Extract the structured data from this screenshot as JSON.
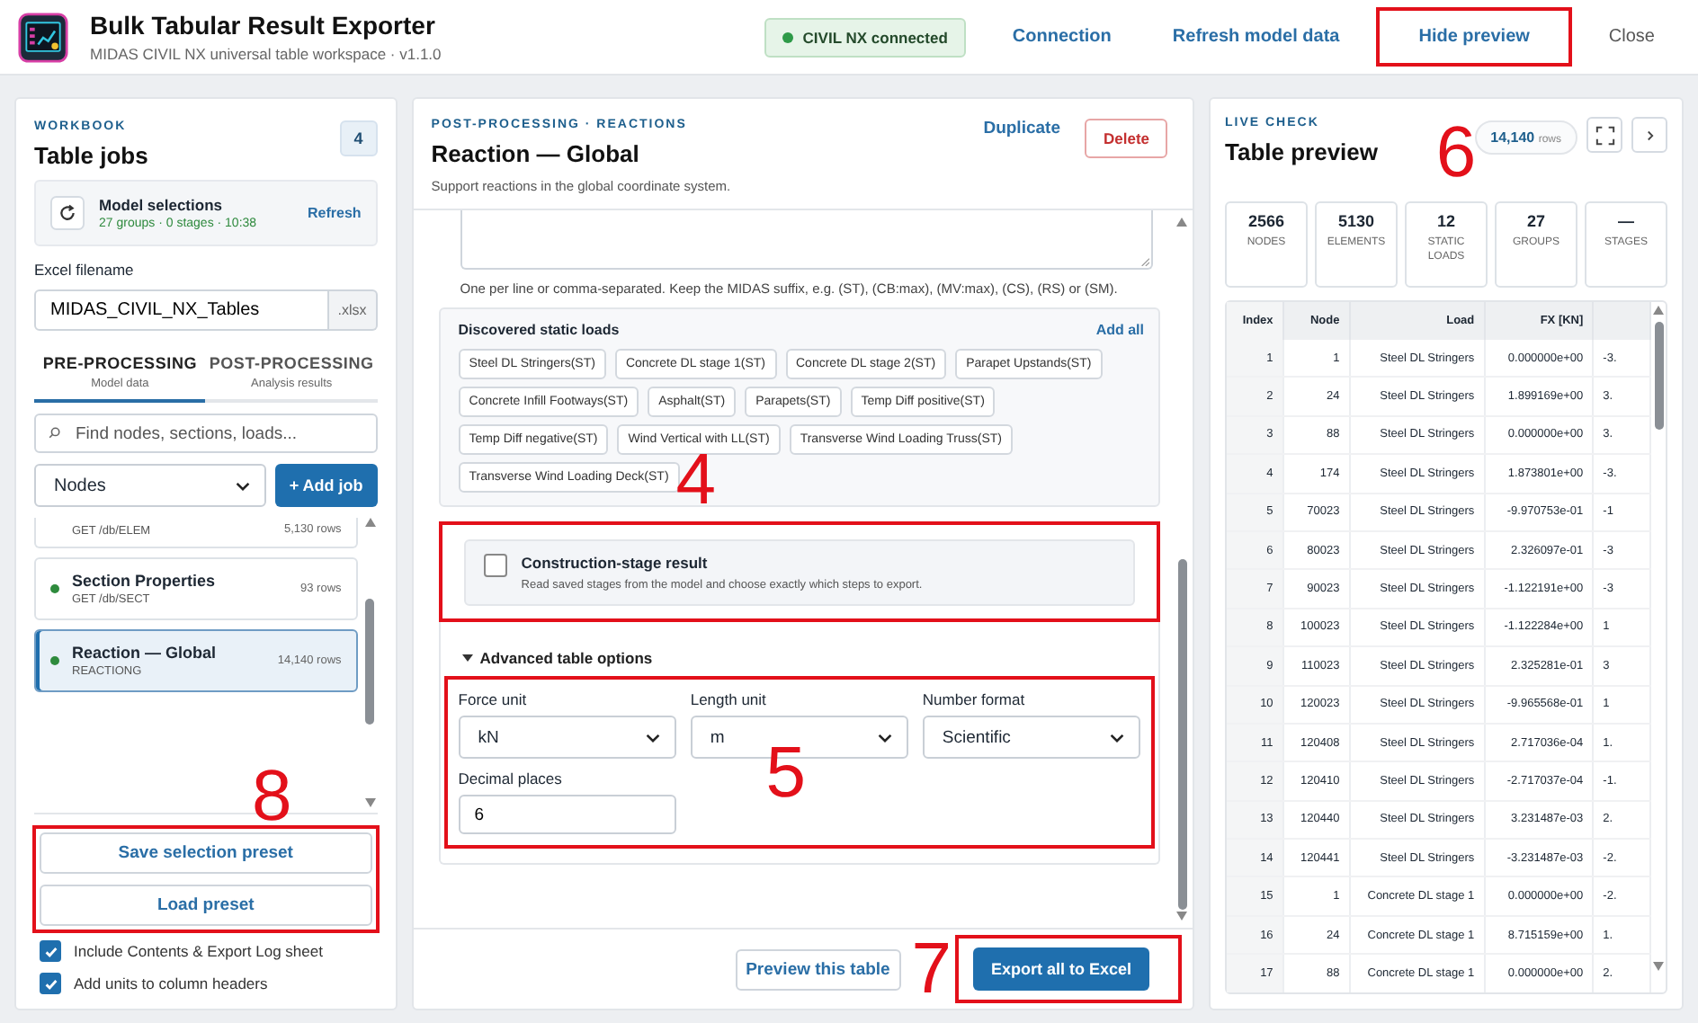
{
  "app": {
    "title": "Bulk Tabular Result Exporter",
    "subtitle": "MIDAS CIVIL NX universal table workspace · v1.1.0"
  },
  "header": {
    "status": "CIVIL NX connected",
    "connected": true,
    "actions": [
      {
        "label": "Connection",
        "boxed": false
      },
      {
        "label": "Refresh model data",
        "boxed": false
      },
      {
        "label": "Hide preview",
        "boxed": true
      },
      {
        "label": "Close",
        "boxed": false
      }
    ]
  },
  "workbook": {
    "eyebrow": "WORKBOOK",
    "title": "Table jobs",
    "count": "4",
    "model": {
      "title": "Model selections",
      "meta": "27 groups · 0 stages · 10:38",
      "action": "Refresh"
    },
    "filename": {
      "label": "Excel filename",
      "value": "MIDAS_CIVIL_NX_Tables",
      "extension": ".xlsx"
    },
    "tabs": [
      {
        "label": "PRE-PROCESSING",
        "sub": "Model data",
        "selected": true
      },
      {
        "label": "POST-PROCESSING",
        "sub": "Analysis results",
        "selected": false
      }
    ],
    "search": {
      "placeholder": "Find nodes, sections, loads..."
    },
    "type_select": "Nodes",
    "add_job": "+ Add job",
    "jobs": [
      {
        "endpoint": "GET /db/ELEM",
        "rows": "5,130 rows",
        "selected": false
      },
      {
        "name": "Section Properties",
        "endpoint": "GET /db/SECT",
        "rows": "93 rows",
        "selected": false
      },
      {
        "name": "Reaction — Global",
        "endpoint": "REACTIONG",
        "rows": "14,140 rows",
        "selected": true
      }
    ],
    "presets": {
      "callout": "8",
      "buttons": [
        "Save selection preset",
        "Load preset"
      ]
    },
    "options": [
      {
        "label": "Include Contents & Export Log sheet",
        "checked": true
      },
      {
        "label": "Add units to column headers",
        "checked": true
      }
    ]
  },
  "editor": {
    "eyebrow": "POST-PROCESSING · REACTIONS",
    "title": "Reaction — Global",
    "description": "Support reactions in the global coordinate system.",
    "duplicate": "Duplicate",
    "delete": "Delete",
    "load_hint": "One per line or comma-separated. Keep the MIDAS suffix, e.g. (ST), (CB:max), (MV:max), (CS), (RS) or (SM).",
    "discovered": {
      "title": "Discovered static loads",
      "action": "Add all",
      "loads": [
        "Steel DL Stringers(ST)",
        "Concrete DL stage 1(ST)",
        "Concrete DL stage 2(ST)",
        "Parapet Upstands(ST)",
        "Concrete Infill Footways(ST)",
        "Asphalt(ST)",
        "Parapets(ST)",
        "Temp Diff positive(ST)",
        "Temp Diff negative(ST)",
        "Wind Vertical with LL(ST)",
        "Transverse Wind Loading Truss(ST)",
        "Transverse Wind Loading Deck(ST)"
      ]
    },
    "construction_stage": {
      "title": "Construction-stage result",
      "description": "Read saved stages from the model and choose exactly which steps to export.",
      "checked": false,
      "callout": "4"
    },
    "advanced": {
      "title": "Advanced table options",
      "expanded": true,
      "callout": "5",
      "fields": [
        {
          "label": "Force unit",
          "value": "kN",
          "kind": "select"
        },
        {
          "label": "Length unit",
          "value": "m",
          "kind": "select"
        },
        {
          "label": "Number format",
          "value": "Scientific",
          "kind": "select"
        },
        {
          "label": "Decimal places",
          "value": "6",
          "kind": "input"
        }
      ]
    },
    "footer": {
      "preview": "Preview this table",
      "export": "Export all to Excel",
      "callout": "7"
    }
  },
  "preview": {
    "eyebrow": "LIVE CHECK",
    "title": "Table preview",
    "callout": "6",
    "rows_count": "14,140",
    "rows_unit": "rows",
    "stats": [
      {
        "value": "2566",
        "label": "NODES"
      },
      {
        "value": "5130",
        "label": "ELEMENTS"
      },
      {
        "value": "12",
        "label": "STATIC LOADS"
      },
      {
        "value": "27",
        "label": "GROUPS"
      },
      {
        "value": "—",
        "label": "STAGES"
      }
    ],
    "table": {
      "columns": [
        "Index",
        "Node",
        "Load",
        "FX [KN]"
      ],
      "rows": [
        [
          "1",
          "1",
          "Steel DL Stringers",
          "0.000000e+00",
          "-3."
        ],
        [
          "2",
          "24",
          "Steel DL Stringers",
          "1.899169e+00",
          "3."
        ],
        [
          "3",
          "88",
          "Steel DL Stringers",
          "0.000000e+00",
          "3."
        ],
        [
          "4",
          "174",
          "Steel DL Stringers",
          "1.873801e+00",
          "-3."
        ],
        [
          "5",
          "70023",
          "Steel DL Stringers",
          "-9.970753e-01",
          "-1"
        ],
        [
          "6",
          "80023",
          "Steel DL Stringers",
          "2.326097e-01",
          "-3"
        ],
        [
          "7",
          "90023",
          "Steel DL Stringers",
          "-1.122191e+00",
          "-3"
        ],
        [
          "8",
          "100023",
          "Steel DL Stringers",
          "-1.122284e+00",
          "1"
        ],
        [
          "9",
          "110023",
          "Steel DL Stringers",
          "2.325281e-01",
          "3"
        ],
        [
          "10",
          "120023",
          "Steel DL Stringers",
          "-9.965568e-01",
          "1"
        ],
        [
          "11",
          "120408",
          "Steel DL Stringers",
          "2.717036e-04",
          "1."
        ],
        [
          "12",
          "120410",
          "Steel DL Stringers",
          "-2.717037e-04",
          "-1."
        ],
        [
          "13",
          "120440",
          "Steel DL Stringers",
          "3.231487e-03",
          "2."
        ],
        [
          "14",
          "120441",
          "Steel DL Stringers",
          "-3.231487e-03",
          "-2."
        ],
        [
          "15",
          "1",
          "Concrete DL stage 1",
          "0.000000e+00",
          "-2."
        ],
        [
          "16",
          "24",
          "Concrete DL stage 1",
          "8.715159e+00",
          "1."
        ],
        [
          "17",
          "88",
          "Concrete DL stage 1",
          "0.000000e+00",
          "2."
        ]
      ]
    }
  }
}
